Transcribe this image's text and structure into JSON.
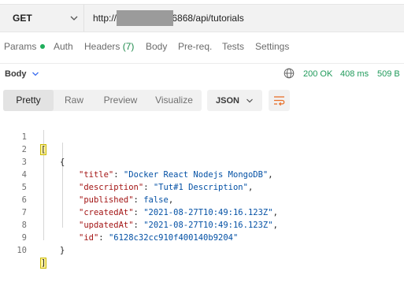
{
  "request": {
    "method": "GET",
    "url_prefix": "http://",
    "url_suffix": ":6868/api/tutorials"
  },
  "request_tabs": {
    "params": "Params",
    "auth": "Auth",
    "headers": "Headers",
    "headers_count": "(7)",
    "body": "Body",
    "prereq": "Pre-req.",
    "tests": "Tests",
    "settings": "Settings"
  },
  "response": {
    "body_label": "Body",
    "status": "200 OK",
    "time": "408 ms",
    "size": "509 B"
  },
  "view": {
    "pretty": "Pretty",
    "raw": "Raw",
    "preview": "Preview",
    "visualize": "Visualize",
    "format": "JSON"
  },
  "colors": {
    "status_green": "#1f9a5a",
    "key_red": "#a31515",
    "value_blue": "#0451a5",
    "wrap_icon_orange": "#e8702a"
  },
  "code": {
    "line_numbers": [
      "1",
      "2",
      "3",
      "4",
      "5",
      "6",
      "7",
      "8",
      "9",
      "10"
    ],
    "open_bracket": "[",
    "open_brace": "{",
    "close_brace": "}",
    "close_bracket": "]",
    "fields": [
      {
        "key": "\"title\"",
        "value": "\"Docker React Nodejs MongoDB\"",
        "sep": ","
      },
      {
        "key": "\"description\"",
        "value": "\"Tut#1 Description\"",
        "sep": ","
      },
      {
        "key": "\"published\"",
        "value": "false",
        "sep": ","
      },
      {
        "key": "\"createdAt\"",
        "value": "\"2021-08-27T10:49:16.123Z\"",
        "sep": ","
      },
      {
        "key": "\"updatedAt\"",
        "value": "\"2021-08-27T10:49:16.123Z\"",
        "sep": ","
      },
      {
        "key": "\"id\"",
        "value": "\"6128c32cc910f400140b9204\"",
        "sep": ""
      }
    ],
    "colon": ": "
  }
}
